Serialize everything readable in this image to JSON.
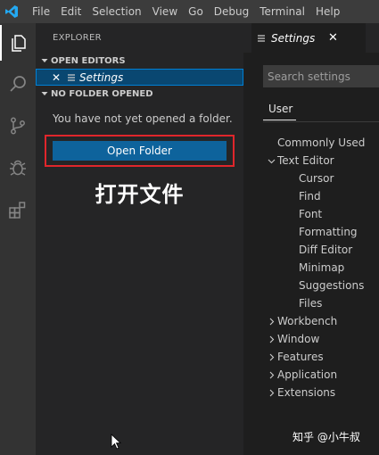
{
  "menubar": {
    "items": [
      "File",
      "Edit",
      "Selection",
      "View",
      "Go",
      "Debug",
      "Terminal",
      "Help"
    ]
  },
  "activitybar": {
    "icons": [
      "files-icon",
      "search-icon",
      "source-control-icon",
      "debug-icon",
      "extensions-icon"
    ]
  },
  "sidebar": {
    "title": "EXPLORER",
    "open_editors": {
      "header": "OPEN EDITORS",
      "items": [
        {
          "name": "Settings"
        }
      ]
    },
    "no_folder": {
      "header": "NO FOLDER OPENED",
      "message": "You have not yet opened a folder.",
      "button": "Open Folder"
    },
    "annotation": "打开文件"
  },
  "editor": {
    "tab": {
      "label": "Settings"
    },
    "search_placeholder": "Search settings",
    "scope_tab": "User",
    "toc": [
      {
        "label": "Commonly Used",
        "level": 0,
        "chevron": "none"
      },
      {
        "label": "Text Editor",
        "level": 0,
        "chevron": "down"
      },
      {
        "label": "Cursor",
        "level": 1,
        "chevron": "none"
      },
      {
        "label": "Find",
        "level": 1,
        "chevron": "none"
      },
      {
        "label": "Font",
        "level": 1,
        "chevron": "none"
      },
      {
        "label": "Formatting",
        "level": 1,
        "chevron": "none"
      },
      {
        "label": "Diff Editor",
        "level": 1,
        "chevron": "none"
      },
      {
        "label": "Minimap",
        "level": 1,
        "chevron": "none"
      },
      {
        "label": "Suggestions",
        "level": 1,
        "chevron": "none"
      },
      {
        "label": "Files",
        "level": 1,
        "chevron": "none"
      },
      {
        "label": "Workbench",
        "level": 0,
        "chevron": "right"
      },
      {
        "label": "Window",
        "level": 0,
        "chevron": "right"
      },
      {
        "label": "Features",
        "level": 0,
        "chevron": "right"
      },
      {
        "label": "Application",
        "level": 0,
        "chevron": "right"
      },
      {
        "label": "Extensions",
        "level": 0,
        "chevron": "right"
      }
    ]
  },
  "watermark": "知乎 @小牛叔",
  "colors": {
    "accent": "#0e639c",
    "highlight_box": "#e0262b",
    "logo": "#23a9f2"
  }
}
